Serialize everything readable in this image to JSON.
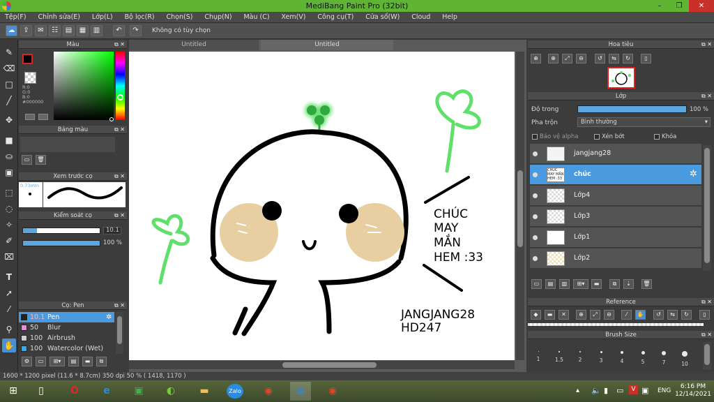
{
  "window": {
    "title": "MediBang Paint Pro (32bit)",
    "min": "–",
    "max": "❐",
    "close": "✕"
  },
  "menu": [
    "Tệp(F)",
    "Chỉnh sửa(E)",
    "Lớp(L)",
    "Bộ lọc(R)",
    "Chọn(S)",
    "Chụp(N)",
    "Màu (C)",
    "Xem(V)",
    "Công cụ(T)",
    "Cửa sổ(W)",
    "Cloud",
    "Help"
  ],
  "toolbar": {
    "option_text": "Không có tùy chọn"
  },
  "tabs": [
    "Untitled",
    "Untitled"
  ],
  "color_panel": {
    "title": "Màu",
    "r": "R:0",
    "g": "G:0",
    "b": "B:0",
    "hex": "#000000"
  },
  "palette_panel": {
    "title": "Bảng màu"
  },
  "brush_preview": {
    "title": "Xem trước cọ",
    "size": "0.73mm"
  },
  "brush_control": {
    "title": "Kiểm soát cọ",
    "size_value": "10.1",
    "opacity_value": "100 %",
    "size_fraction": 0.7,
    "opacity_fraction": 1.0
  },
  "brushes": {
    "title": "Cọ: Pen",
    "items": [
      {
        "size": "10.1",
        "name": "Pen",
        "color": "#222222"
      },
      {
        "size": "50",
        "name": "Blur",
        "color": "#e58ce0"
      },
      {
        "size": "100",
        "name": "Airbrush",
        "color": "#cfcfcf"
      },
      {
        "size": "100",
        "name": "Watercolor (Wet)",
        "color": "#3ea6e8"
      }
    ]
  },
  "navigator": {
    "title": "Hoa tiêu"
  },
  "layers_panel": {
    "title": "Lớp",
    "opacity_label": "Độ trong",
    "opacity_value": "100 %",
    "opacity_fraction": 1.0,
    "blend_label": "Pha trộn",
    "blend_value": "Bình thường",
    "protect_alpha": "Bảo vệ alpha",
    "clipping": "Xén bớt",
    "lock": "Khóa",
    "layers": [
      {
        "name": "jangjang28",
        "thumb": ""
      },
      {
        "name": "chúc",
        "thumb": "CHÚC MAY MẮN HEM :33"
      },
      {
        "name": "Lớp4",
        "thumb": ""
      },
      {
        "name": "Lớp3",
        "thumb": ""
      },
      {
        "name": "Lớp1",
        "thumb": ""
      },
      {
        "name": "Lớp2",
        "thumb": ""
      }
    ]
  },
  "reference": {
    "title": "Reference"
  },
  "brush_size_panel": {
    "title": "Brush Size",
    "sizes": [
      "1",
      "1.5",
      "2",
      "3",
      "4",
      "5",
      "7",
      "10"
    ]
  },
  "canvas_text": {
    "wish_line1": "CHÚC",
    "wish_line2": "MAY",
    "wish_line3": "MẮN",
    "wish_line4": "HEM :33",
    "sign_line1": "JANGJANG28",
    "sign_line2": "HD247"
  },
  "status": {
    "text": "1600 * 1200 pixel   (11.6 * 8.7cm)   350 dpi   50 %   ( 1418, 1170 )"
  },
  "taskbar": {
    "lang": "ENG",
    "time": "6:16 PM",
    "date": "12/14/2021",
    "zalo": "Zalo"
  },
  "colors": {
    "title_green": "#5fb533",
    "selection_blue": "#4a9ae0",
    "clover_green": "#5ee06b",
    "cheek": "#e8cfa2"
  }
}
